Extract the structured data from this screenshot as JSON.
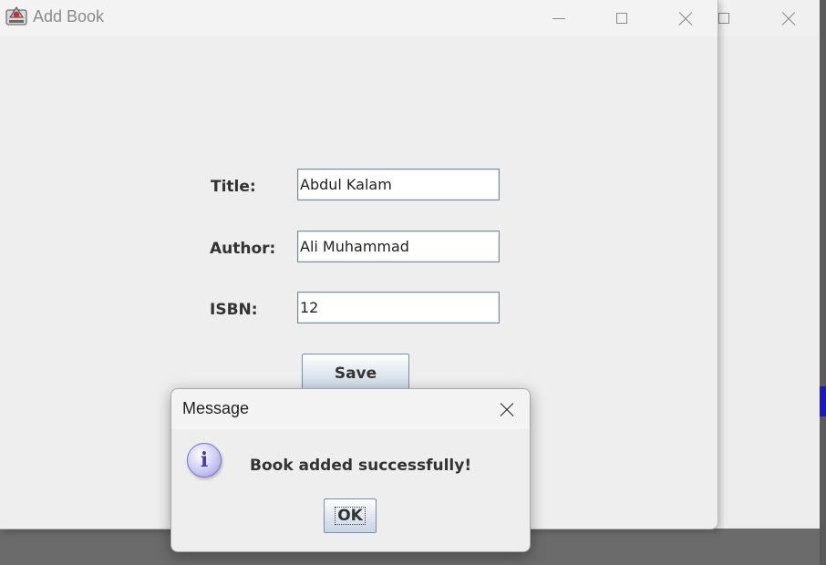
{
  "background_window": {
    "controls": [
      "maximize",
      "close"
    ]
  },
  "main_window": {
    "title": "Add Book",
    "controls": [
      "minimize",
      "maximize",
      "close"
    ]
  },
  "form": {
    "title_label": "Title:",
    "title_value": "Abdul Kalam",
    "author_label": "Author:",
    "author_value": "Ali Muhammad",
    "isbn_label": "ISBN:",
    "isbn_value": "12",
    "save_label": "Save"
  },
  "dialog": {
    "title": "Message",
    "icon": "i",
    "message": "Book added successfully!",
    "ok_label": "OK"
  },
  "colors": {
    "edge_accent": "#1a1ac4",
    "button_gradient_bottom": "#c9d5e3",
    "info_icon": "#c7c4f3"
  }
}
